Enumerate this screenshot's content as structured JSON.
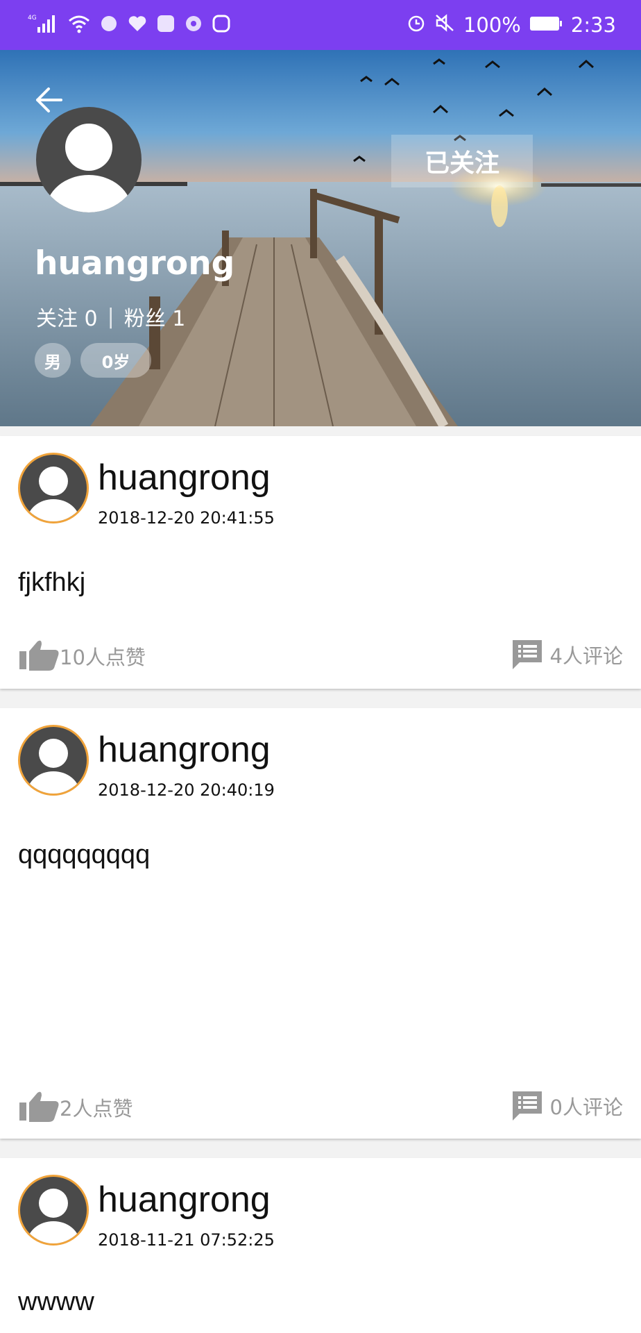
{
  "status_bar": {
    "network": "4G",
    "battery": "100%",
    "time": "2:33"
  },
  "profile": {
    "name": "huangrong",
    "following_label": "关注",
    "following_count": "0",
    "followers_label": "粉丝",
    "followers_count": "1",
    "gender": "男",
    "age": "0岁",
    "follow_button": "已关注"
  },
  "posts": [
    {
      "author": "huangrong",
      "time": "2018-12-20 20:41:55",
      "content": "fjkfhkj",
      "likes": "10人点赞",
      "comments": "4人评论"
    },
    {
      "author": "huangrong",
      "time": "2018-12-20 20:40:19",
      "content": "qqqqqqqqq",
      "likes": "2人点赞",
      "comments": "0人评论"
    },
    {
      "author": "huangrong",
      "time": "2018-11-21 07:52:25",
      "content": "wwww"
    }
  ],
  "colors": {
    "status_bar": "#7c3ff0",
    "avatar_ring": "#f0a33a",
    "meta_text": "#999999"
  },
  "icons": [
    "back-arrow-icon",
    "avatar-icon",
    "thumbs-up-icon",
    "comment-icon"
  ]
}
